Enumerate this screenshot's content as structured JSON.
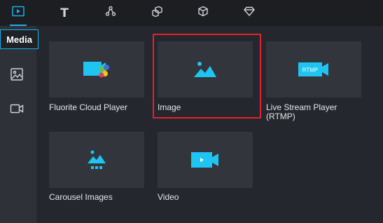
{
  "toolbar": {
    "items": [
      {
        "icon": "video-play-icon",
        "active": true
      },
      {
        "icon": "text-icon",
        "label": "T"
      },
      {
        "icon": "share-nodes-icon"
      },
      {
        "icon": "layers-cube-icon"
      },
      {
        "icon": "cube-icon"
      },
      {
        "icon": "diamond-icon"
      }
    ]
  },
  "sidebar": {
    "media_label": "Media",
    "items": [
      {
        "icon": "image-icon"
      },
      {
        "icon": "camera-icon"
      }
    ]
  },
  "components": [
    {
      "label": "Fluorite Cloud Player",
      "icon": "cloud-player-icon"
    },
    {
      "label": "Image",
      "icon": "image-icon",
      "selected": true
    },
    {
      "label": "Live Stream Player (RTMP)",
      "icon": "rtmp-player-icon",
      "badge": "RTMP"
    },
    {
      "label": "Carousel Images",
      "icon": "carousel-icon"
    },
    {
      "label": "Video",
      "icon": "video-icon"
    }
  ],
  "colors": {
    "accent": "#1aaee5",
    "highlight": "#e0242b",
    "icon_blue": "#1ec4f2"
  }
}
